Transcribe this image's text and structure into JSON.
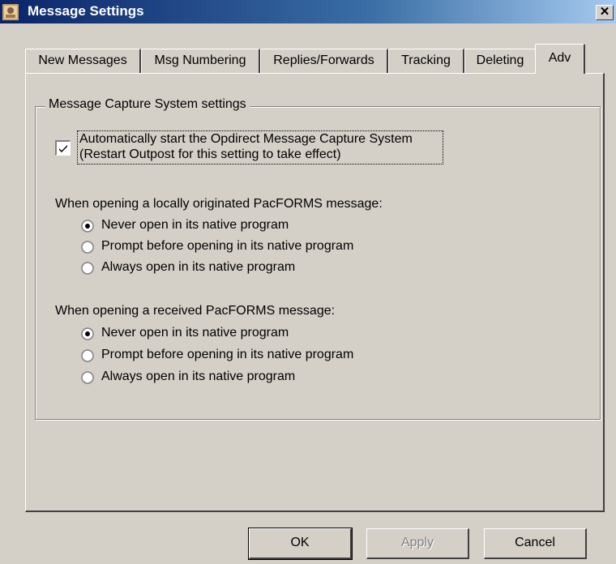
{
  "window": {
    "title": "Message Settings",
    "close_glyph": "✕"
  },
  "tabs": [
    {
      "label": "New Messages",
      "active": false
    },
    {
      "label": "Msg Numbering",
      "active": false
    },
    {
      "label": "Replies/Forwards",
      "active": false
    },
    {
      "label": "Tracking",
      "active": false
    },
    {
      "label": "Deleting",
      "active": false
    },
    {
      "label": "Adv",
      "active": true
    }
  ],
  "group": {
    "title": "Message Capture System settings",
    "auto_start": {
      "checked": true,
      "line1": "Automatically start the Opdirect Message Capture System",
      "line2": "(Restart Outpost for this setting to take effect)"
    }
  },
  "local_section": {
    "label": "When opening a locally originated PacFORMS message:",
    "options": [
      {
        "label": "Never open in its native program",
        "selected": true
      },
      {
        "label": "Prompt before opening in its native program",
        "selected": false
      },
      {
        "label": "Always open in its native program",
        "selected": false
      }
    ]
  },
  "received_section": {
    "label": "When opening a received PacFORMS message:",
    "options": [
      {
        "label": "Never open in its native program",
        "selected": true
      },
      {
        "label": "Prompt before opening in its native program",
        "selected": false
      },
      {
        "label": "Always open in its native program",
        "selected": false
      }
    ]
  },
  "buttons": {
    "ok": "OK",
    "apply": "Apply",
    "cancel": "Cancel"
  },
  "icons": {
    "app": "outpost-app-icon",
    "check": "checkmark-icon",
    "radio": "radio-button-icon"
  }
}
